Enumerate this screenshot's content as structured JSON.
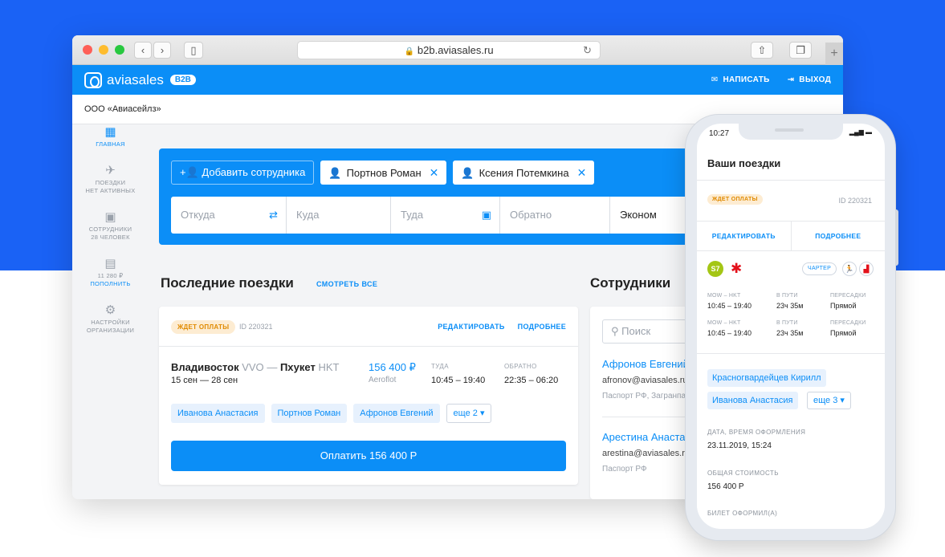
{
  "browser": {
    "url": "b2b.aviasales.ru"
  },
  "app": {
    "logo_text": "aviasales",
    "logo_badge": "B2B",
    "write_label": "НАПИСАТЬ",
    "logout_label": "ВЫХОД",
    "org_name": "ООО «Авиасейлз»"
  },
  "sidebar": {
    "items": [
      {
        "label": "ГЛАВНАЯ",
        "icon": "dashboard-icon"
      },
      {
        "label": "ПОЕЗДКИ",
        "sub": "НЕТ АКТИВНЫХ",
        "icon": "plane-icon"
      },
      {
        "label": "СОТРУДНИКИ",
        "sub": "28 ЧЕЛОВЕК",
        "icon": "folder-user-icon"
      },
      {
        "label": "11 280 ₽",
        "sub": "ПОПОЛНИТЬ",
        "icon": "wallet-icon"
      },
      {
        "label": "НАСТРОЙКИ",
        "sub": "ОРГАНИЗАЦИИ",
        "icon": "settings-icon"
      }
    ]
  },
  "search": {
    "add_employee": "Добавить сотрудника",
    "passengers": [
      "Портнов Роман",
      "Ксения Потемкина"
    ],
    "from_placeholder": "Откуда",
    "to_placeholder": "Куда",
    "depart_placeholder": "Туда",
    "return_placeholder": "Обратно",
    "class_value": "Эконом"
  },
  "recent": {
    "title": "Последние поездки",
    "see_all": "СМОТРЕТЬ ВСЕ",
    "trip": {
      "status": "ЖДЕТ ОПЛАТЫ",
      "id": "ID 220321",
      "edit": "РЕДАКТИРОВАТЬ",
      "details": "ПОДРОБНЕЕ",
      "from_city": "Владивосток",
      "from_code": "VVO",
      "dash": "—",
      "to_city": "Пхукет",
      "to_code": "HKT",
      "dates": "15 сен — 28 сен",
      "price": "156 400 ₽",
      "airline": "Aeroflot",
      "there_label": "ТУДА",
      "there_time": "10:45 – 19:40",
      "back_label": "ОБРАТНО",
      "back_time": "22:35 – 06:20",
      "passengers": [
        "Иванова Анастасия",
        "Портнов Роман",
        "Афронов Евгений"
      ],
      "more": "еще 2",
      "pay": "Оплатить 156 400 Р"
    }
  },
  "employees": {
    "title": "Сотрудники",
    "search_placeholder": "Поиск",
    "list": [
      {
        "name": "Афронов Евгений",
        "email": "afronov@aviasales.ru",
        "doc": "Паспорт РФ, Загранпаспорт"
      },
      {
        "name": "Арестина Анастасия",
        "email": "arestina@aviasales.ru",
        "doc": "Паспорт РФ"
      }
    ]
  },
  "phone": {
    "time": "10:27",
    "title": "Ваши поездки",
    "status": "ЖДЕТ ОПЛАТЫ",
    "id": "ID 220321",
    "edit": "РЕДАКТИРОВАТЬ",
    "details": "ПОДРОБНЕЕ",
    "s7": "S7",
    "charter": "ЧАРТЕР",
    "segments": [
      {
        "route": "MOW – HKT",
        "time": "10:45 – 19:40",
        "dur_label": "В ПУТИ",
        "duration": "23ч 35м",
        "transfer_label": "ПЕРЕСАДКИ",
        "transfer": "Прямой"
      },
      {
        "route": "MOW – HKT",
        "time": "10:45 – 19:40",
        "dur_label": "В ПУТИ",
        "duration": "23ч 35м",
        "transfer_label": "ПЕРЕСАДКИ",
        "transfer": "Прямой"
      }
    ],
    "passengers": [
      "Красногвардейцев Кирилл",
      "Иванова Анастасия"
    ],
    "more": "еще 3",
    "date_label": "ДАТА, ВРЕМЯ ОФОРМЛЕНИЯ",
    "date_value": "23.11.2019, 15:24",
    "cost_label": "ОБЩАЯ СТОИМОСТЬ",
    "cost_value": "156 400 Р",
    "issuer_label": "БИЛЕТ ОФОРМИЛ(А)"
  },
  "colors": {
    "accent": "#0b8ef7",
    "background_blue": "#1a62f5",
    "status_wait": "#e08a00"
  }
}
